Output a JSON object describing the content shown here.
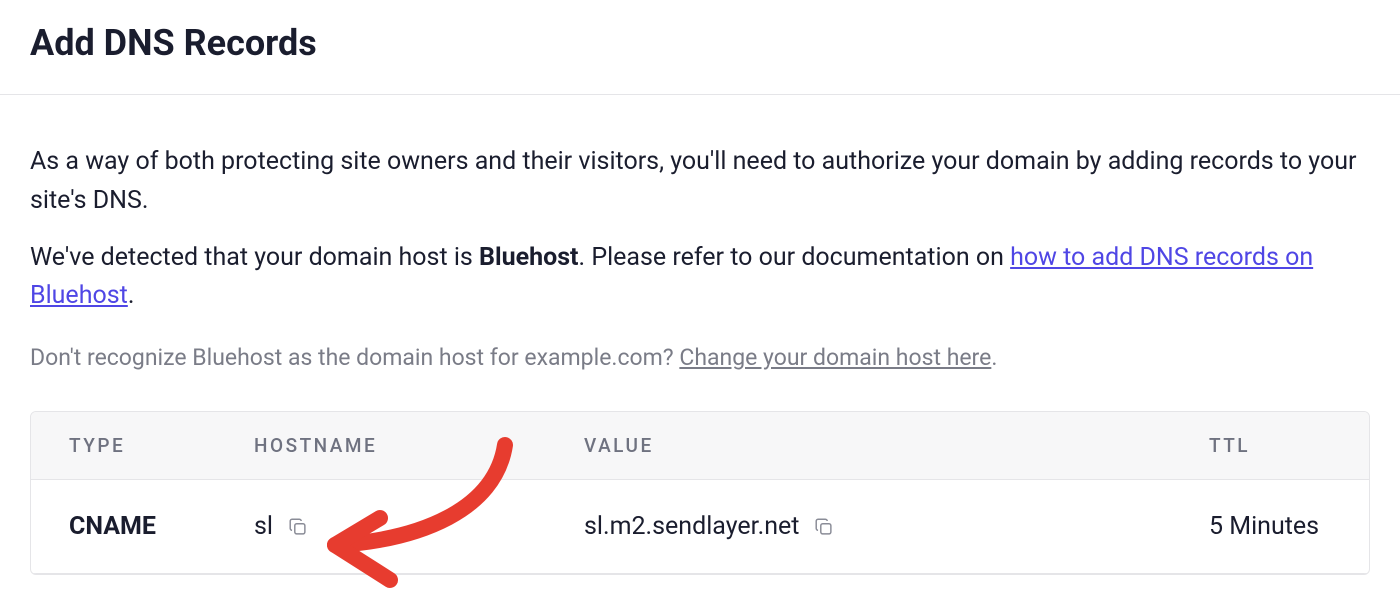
{
  "title": "Add DNS Records",
  "intro": {
    "p1": "As a way of both protecting site owners and their visitors, you'll need to authorize your domain by adding records to your site's DNS.",
    "p2_prefix": "We've detected that your domain host is ",
    "p2_host": "Bluehost",
    "p2_middle": ". Please refer to our documentation on ",
    "p2_link": "how to add DNS records on Bluehost",
    "p2_suffix": "."
  },
  "muted": {
    "prefix": "Don't recognize Bluehost as the domain host for example.com? ",
    "link": "Change your domain host here",
    "suffix": "."
  },
  "table": {
    "headers": {
      "type": "TYPE",
      "hostname": "HOSTNAME",
      "value": "VALUE",
      "ttl": "TTL"
    },
    "rows": [
      {
        "type": "CNAME",
        "hostname": "sl",
        "value": "sl.m2.sendlayer.net",
        "ttl": "5 Minutes"
      }
    ]
  }
}
